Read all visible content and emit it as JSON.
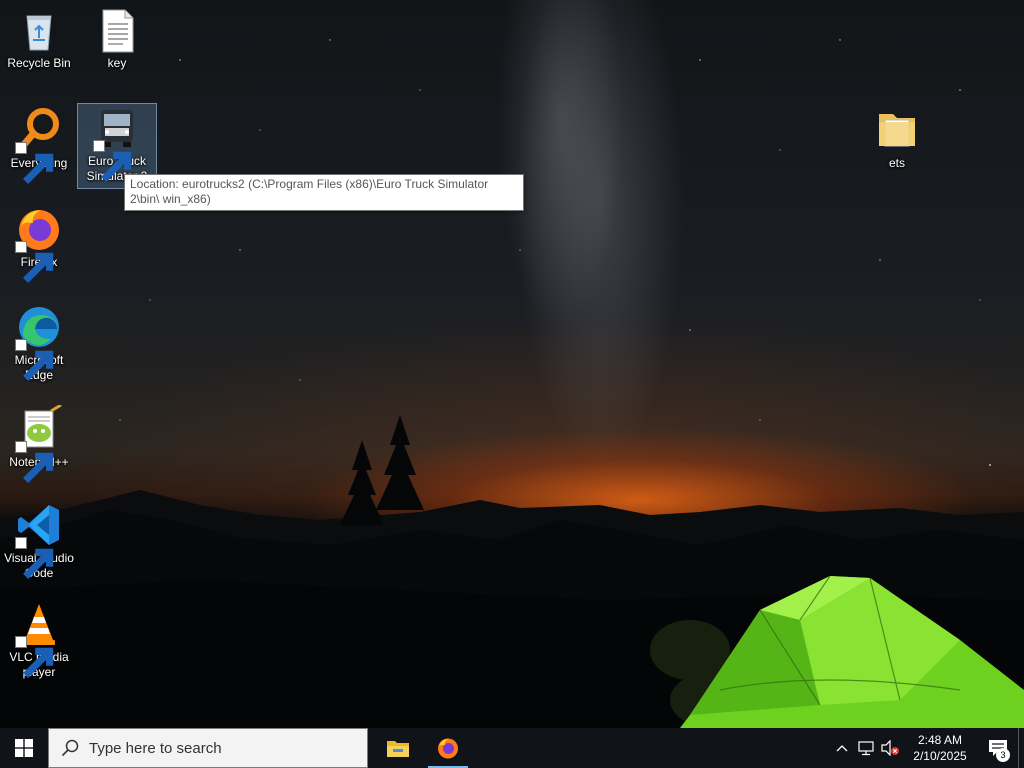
{
  "desktop": {
    "icons": [
      {
        "label": "Recycle Bin",
        "icon": "recycle-bin-icon"
      },
      {
        "label": "key",
        "icon": "text-file-icon"
      },
      {
        "label": "Everything",
        "icon": "everything-search-icon"
      },
      {
        "label": "Euro Truck\nSimulator 2",
        "icon": "euro-truck-simulator-icon"
      },
      {
        "label": "ets",
        "icon": "folder-icon"
      },
      {
        "label": "Firefox",
        "icon": "firefox-icon"
      },
      {
        "label": "Microsoft\nEdge",
        "icon": "edge-icon"
      },
      {
        "label": "Notepad++",
        "icon": "notepad-plus-plus-icon"
      },
      {
        "label": "Visual Studio\nCode",
        "icon": "vscode-icon"
      },
      {
        "label": "VLC media\nplayer",
        "icon": "vlc-icon"
      }
    ],
    "tooltip": "Location: eurotrucks2 (C:\\Program Files (x86)\\Euro Truck Simulator 2\\bin\\ win_x86)"
  },
  "taskbar": {
    "search_placeholder": "Type here to search",
    "pinned": [
      {
        "name": "File Explorer",
        "icon": "file-explorer-icon"
      },
      {
        "name": "Firefox",
        "icon": "firefox-icon",
        "active": true
      }
    ],
    "clock_time": "2:48 AM",
    "clock_date": "2/10/2025",
    "notification_count": "3"
  },
  "colors": {
    "accent": "#76b9ed",
    "taskbar": "#101317",
    "tent": "#7ee02a"
  }
}
